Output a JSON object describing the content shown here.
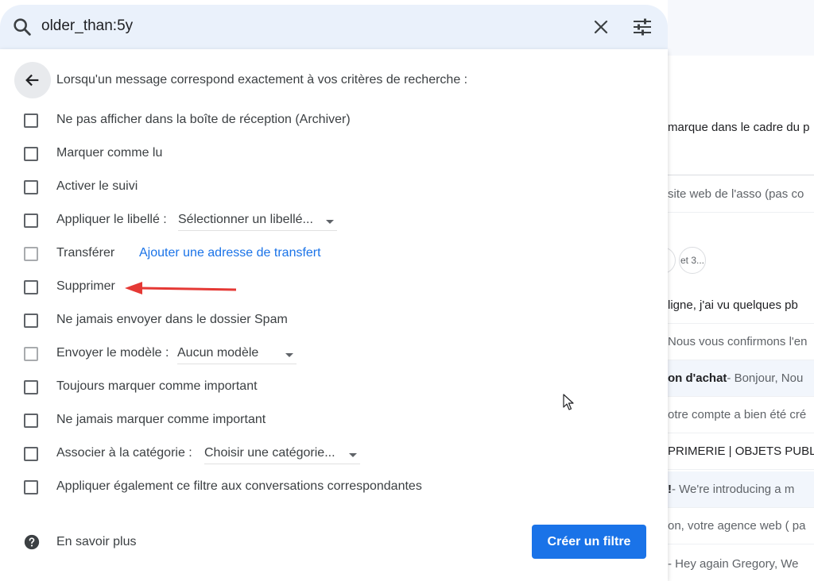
{
  "search": {
    "query": "older_than:5y"
  },
  "dialog": {
    "title": "Lorsqu'un message correspond exactement à vos critères de recherche :",
    "options": [
      {
        "label": "Ne pas afficher dans la boîte de réception (Archiver)",
        "enabled": true
      },
      {
        "label": "Marquer comme lu",
        "enabled": true
      },
      {
        "label": "Activer le suivi",
        "enabled": true
      },
      {
        "label": "Appliquer le libellé :",
        "select": "Sélectionner un libellé...",
        "enabled": true
      },
      {
        "label": "Transférer",
        "link": "Ajouter une adresse de transfert",
        "enabled": false
      },
      {
        "label": "Supprimer",
        "enabled": true
      },
      {
        "label": "Ne jamais envoyer dans le dossier Spam",
        "enabled": true
      },
      {
        "label": "Envoyer le modèle :",
        "select": "Aucun modèle",
        "enabled": false
      },
      {
        "label": "Toujours marquer comme important",
        "enabled": true
      },
      {
        "label": "Ne jamais marquer comme important",
        "enabled": true
      },
      {
        "label": "Associer à la catégorie :",
        "select": "Choisir une catégorie...",
        "enabled": true
      },
      {
        "label": "Appliquer également ce filtre aux conversations correspondantes",
        "enabled": true
      }
    ],
    "help_label": "En savoir plus",
    "create_button": "Créer un filtre"
  },
  "background_list": {
    "rows": [
      {
        "bold": "",
        "snippet": "marque dans le cadre du p"
      },
      {
        "bold": "",
        "snippet": "site web de l'asso (pas co"
      },
      {
        "bold": "",
        "snippet": "et 3..."
      },
      {
        "bold": "",
        "snippet": "ligne, j'ai vu quelques pb"
      },
      {
        "bold": "",
        "snippet": "Nous vous confirmons l'en"
      },
      {
        "bold": "on d'achat",
        "snippet": " - Bonjour, Nou"
      },
      {
        "bold": "",
        "snippet": "otre compte a bien été cré"
      },
      {
        "bold": "",
        "snippet": "PRIMERIE | OBJETS PUBL"
      },
      {
        "bold": "!",
        "snippet": " - We're introducing a m"
      },
      {
        "bold": "",
        "snippet": "on, votre agence web ( pa"
      },
      {
        "bold": "",
        "snippet": "- Hey again Gregory, We"
      }
    ]
  },
  "colors": {
    "accent": "#1a73e8",
    "annotation_arrow": "#e53935",
    "search_bg": "#eaf1fb"
  }
}
